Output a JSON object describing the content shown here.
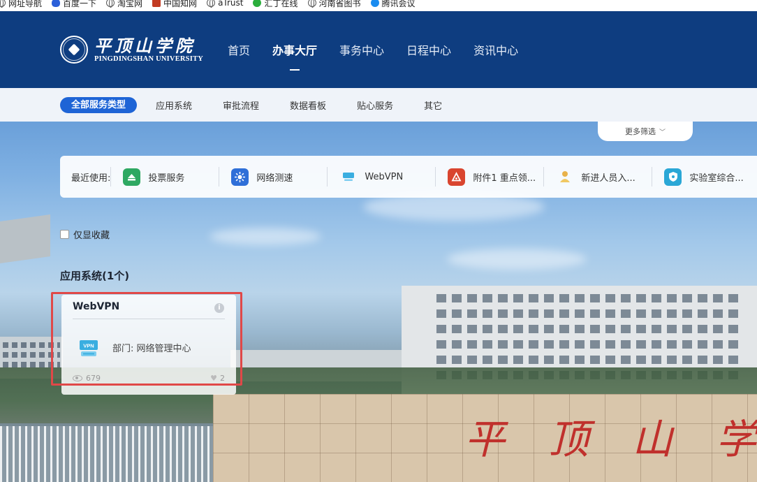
{
  "bookmarks": [
    {
      "label": "网址导航",
      "icon": "globe-icon"
    },
    {
      "label": "百度一下",
      "icon": "baidu-paw-icon"
    },
    {
      "label": "淘宝网",
      "icon": "globe-icon"
    },
    {
      "label": "中国知网",
      "icon": "cnki-icon"
    },
    {
      "label": "aTrust",
      "icon": "globe-icon"
    },
    {
      "label": "汇丁在线",
      "icon": "wechat-icon"
    },
    {
      "label": "河南省图书",
      "icon": "globe-icon"
    },
    {
      "label": "腾讯会议",
      "icon": "tencent-icon"
    }
  ],
  "logo": {
    "cn": "平顶山学院",
    "en": "PINGDINGSHAN UNIVERSITY"
  },
  "nav": [
    {
      "label": "首页",
      "active": false
    },
    {
      "label": "办事大厅",
      "active": true
    },
    {
      "label": "事务中心",
      "active": false
    },
    {
      "label": "日程中心",
      "active": false
    },
    {
      "label": "资讯中心",
      "active": false
    }
  ],
  "categories": [
    {
      "label": "全部服务类型",
      "active": true
    },
    {
      "label": "应用系统",
      "active": false
    },
    {
      "label": "审批流程",
      "active": false
    },
    {
      "label": "数据看板",
      "active": false
    },
    {
      "label": "贴心服务",
      "active": false
    },
    {
      "label": "其它",
      "active": false
    }
  ],
  "more_filter": "更多筛选",
  "recent": {
    "label": "最近使用:",
    "items": [
      {
        "label": "投票服务",
        "icon": "vote-icon",
        "color": "#2ea862"
      },
      {
        "label": "网络测速",
        "icon": "network-speed-icon",
        "color": "#2f6fd8"
      },
      {
        "label": "WebVPN",
        "icon": "vpn-icon",
        "color": "#3aaee0"
      },
      {
        "label": "附件1 重点领...",
        "icon": "attachment-icon",
        "color": "#d9452f"
      },
      {
        "label": "新进人员入...",
        "icon": "new-staff-icon",
        "color": "#e8b24a"
      },
      {
        "label": "实验室综合...",
        "icon": "lab-shield-icon",
        "color": "#2aa7d6"
      }
    ]
  },
  "favorites_only": "仅显收藏",
  "section_title": "应用系统(1个)",
  "card": {
    "title": "WebVPN",
    "info": "i",
    "dept": "部门: 网络管理中心",
    "views": "679",
    "likes": "2",
    "vpn_badge": "VPN"
  },
  "wall_text": "平顶山学"
}
